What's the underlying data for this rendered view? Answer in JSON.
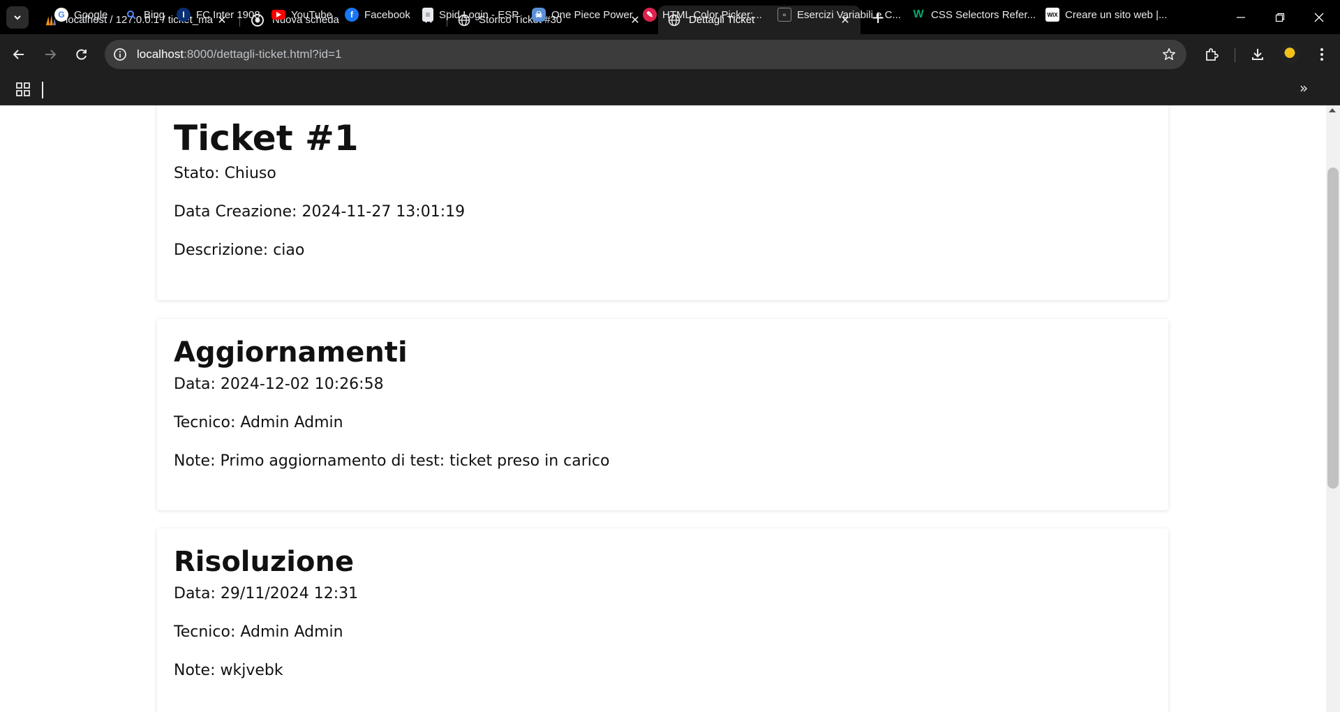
{
  "browser": {
    "tabs": [
      {
        "title": "localhost / 127.0.0.1 / ticket_ma",
        "icon": "phpmyadmin-icon",
        "close": "✕"
      },
      {
        "title": "Nuova scheda",
        "icon": "chrome-icon",
        "close": "✕"
      },
      {
        "title": "Storico Ticket #30",
        "icon": "globe-icon",
        "close": "✕"
      },
      {
        "title": "Dettagli Ticket",
        "icon": "globe-icon",
        "close": "✕",
        "active": true
      }
    ],
    "new_tab": "+",
    "url_host": "localhost",
    "url_rest": ":8000/dettagli-ticket.html?id=1",
    "bookmarks": [
      {
        "label": "Google",
        "icon": "google-icon"
      },
      {
        "label": "Bing",
        "icon": "bing-search-icon"
      },
      {
        "label": "FC Inter 1908",
        "icon": "inter-icon"
      },
      {
        "label": "YouTube",
        "icon": "youtube-icon"
      },
      {
        "label": "Facebook",
        "icon": "facebook-icon"
      },
      {
        "label": "Spid Login - ESP",
        "icon": "document-icon"
      },
      {
        "label": "One Piece Power",
        "icon": "onepiece-icon"
      },
      {
        "label": "HTML Color Picker:...",
        "icon": "colorpicker-icon"
      },
      {
        "label": "Esercizi Variabili e C...",
        "icon": "page-icon"
      },
      {
        "label": "CSS Selectors Refer...",
        "icon": "w3-icon"
      },
      {
        "label": "Creare un sito web |...",
        "icon": "wix-icon"
      }
    ],
    "more": "»"
  },
  "ticket": {
    "title": "Ticket #1",
    "stato": "Stato: Chiuso",
    "data_creazione": "Data Creazione: 2024-11-27 13:01:19",
    "descrizione": "Descrizione: ciao"
  },
  "aggiornamenti": {
    "title": "Aggiornamenti",
    "data": "Data: 2024-12-02 10:26:58",
    "tecnico": "Tecnico: Admin Admin",
    "note": "Note: Primo aggiornamento di test: ticket preso in carico"
  },
  "risoluzione": {
    "title": "Risoluzione",
    "data": "Data: 29/11/2024 12:31",
    "tecnico": "Tecnico: Admin Admin",
    "note": "Note: wkjvebk"
  },
  "colors": {
    "chrome_bg": "#000000",
    "toolbar_bg": "#1f1f1f",
    "omnibox_bg": "#3c3c3c",
    "page_bg": "#ffffff",
    "text": "#111111"
  }
}
